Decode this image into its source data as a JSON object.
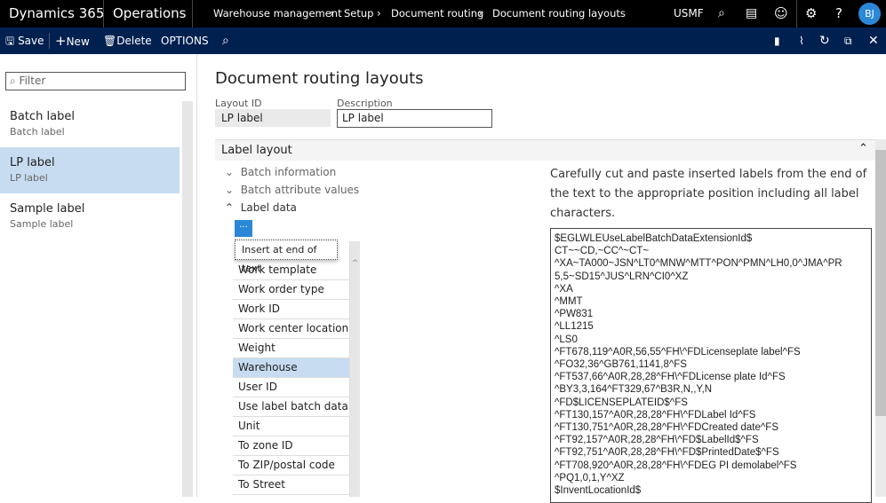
{
  "topbar": {
    "brand": "Dynamics 365",
    "app": "Operations",
    "breadcrumb": [
      "Warehouse management",
      "Setup",
      "Document routing",
      "Document routing layouts"
    ],
    "company": "USMF",
    "user_initials": "BJ"
  },
  "actions": {
    "save": "Save",
    "new": "New",
    "delete": "Delete",
    "options": "OPTIONS"
  },
  "filter": {
    "placeholder": "Filter",
    "value": ""
  },
  "list": [
    {
      "title": "Batch label",
      "sub": "Batch label",
      "selected": false
    },
    {
      "title": "LP label",
      "sub": "LP label",
      "selected": true
    },
    {
      "title": "Sample label",
      "sub": "Sample label",
      "selected": false
    }
  ],
  "page_title": "Document routing layouts",
  "fields": {
    "layout_id_label": "Layout ID",
    "layout_id": "LP label",
    "description_label": "Description",
    "description": "LP label"
  },
  "section": {
    "title": "Label layout",
    "tree": [
      "Batch information",
      "Batch attribute values",
      "Label data"
    ]
  },
  "insert_button": "···",
  "insert_menu": "Insert at end of text",
  "label_fields": [
    "Work template",
    "Work order type",
    "Work ID",
    "Work center location",
    "Weight",
    "Warehouse",
    "User ID",
    "Use label batch data ...",
    "Unit",
    "To zone ID",
    "To ZIP/postal code",
    "To Street"
  ],
  "selected_field": "Warehouse",
  "hint": "Carefully cut and paste inserted labels from the end of the text to the appropriate position including all label characters.",
  "label_text": "$EGLWLEUseLabelBatchDataExtensionId$\nCT~~CD,~CC^~CT~\n^XA~TA000~JSN^LT0^MNW^MTT^PON^PMN^LH0,0^JMA^PR\n5,5~SD15^JUS^LRN^CI0^XZ\n^XA\n^MMT\n^PW831\n^LL1215\n^LS0\n^FT678,119^A0R,56,55^FH\\^FDLicenseplate label^FS\n^FO32,36^GB761,1141,8^FS\n^FT537,66^A0R,28,28^FH\\^FDLicense plate Id^FS\n^BY3,3,164^FT329,67^B3R,N,,Y,N\n^FD$LICENSEPLATEID$^FS\n^FT130,157^A0R,28,28^FH\\^FDLabel Id^FS\n^FT130,751^A0R,28,28^FH\\^FDCreated date^FS\n^FT92,157^A0R,28,28^FH\\^FD$LabelId$^FS\n^FT92,751^A0R,28,28^FH\\^FD$PrintedDate$^FS\n^FT708,920^A0R,28,28^FH\\^FDEG PI demolabel^FS\n^PQ1,0,1,Y^XZ\n$InventLocationId$",
  "colors": {
    "topbar": "#000000",
    "commandbar": "#002050",
    "accent": "#2b88d8",
    "selected": "#c7dcf0"
  }
}
